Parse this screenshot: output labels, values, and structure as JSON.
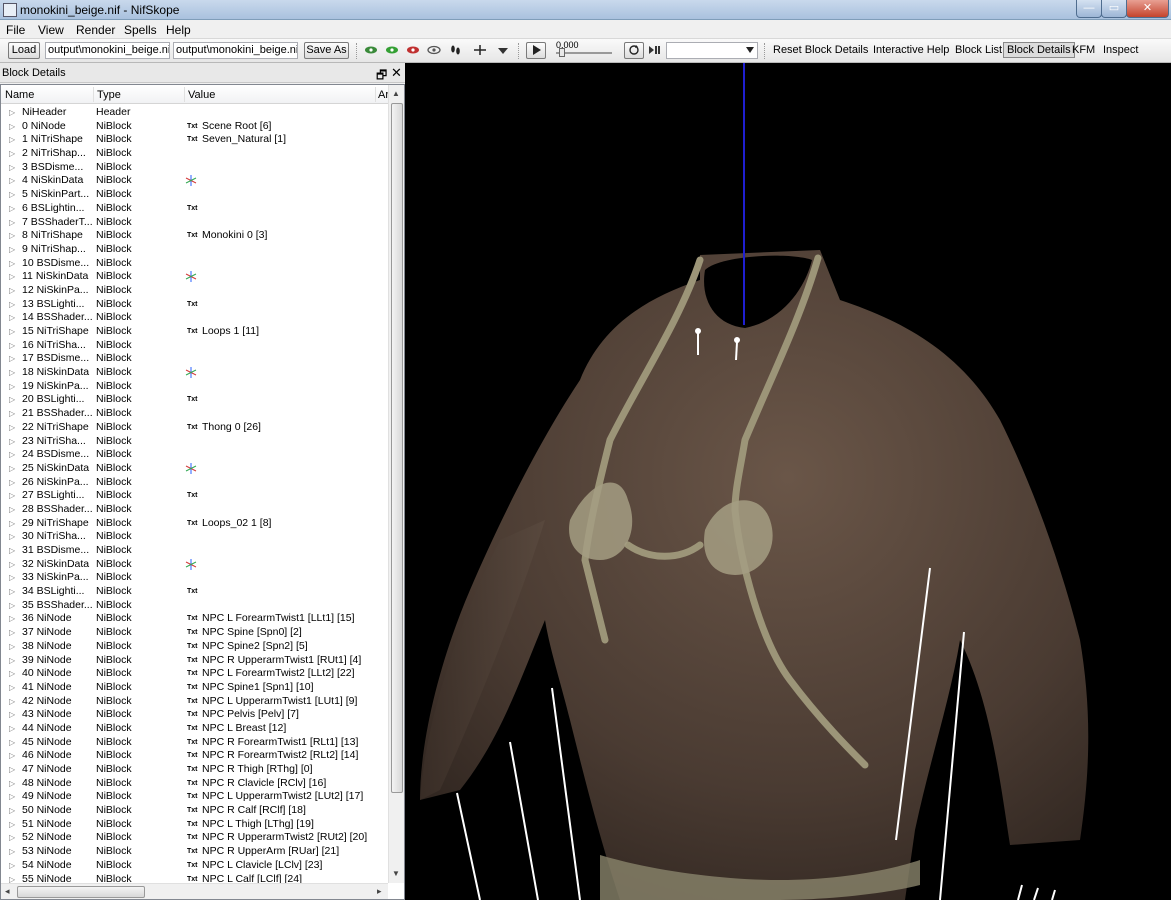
{
  "window": {
    "title": "monokini_beige.nif - NifSkope",
    "min_glyph": "—",
    "max_glyph": "▭",
    "close_glyph": "✕"
  },
  "menu": {
    "file": "File",
    "view": "View",
    "render": "Render",
    "spells": "Spells",
    "help": "Help"
  },
  "toolbar": {
    "load": "Load",
    "load_path": "output\\monokini_beige.nif",
    "save_path": "output\\monokini_beige.nif",
    "save_as": "Save As",
    "time_value": "0.000",
    "reset_block_details": "Reset Block Details",
    "interactive_help": "Interactive Help",
    "block_list": "Block List",
    "block_details": "Block Details",
    "kfm": "KFM",
    "inspect": "Inspect"
  },
  "dock": {
    "title": "Block Details",
    "float_glyph": "🗗",
    "close_glyph": "✕"
  },
  "columns": {
    "name": "Name",
    "type": "Type",
    "value": "Value",
    "arg": "Ar"
  },
  "value_tag": "Txt",
  "rows": [
    {
      "name": "NiHeader",
      "type": "Header",
      "kind": "",
      "value": ""
    },
    {
      "name": "0 NiNode",
      "type": "NiBlock",
      "kind": "txt",
      "value": "Scene Root [6]"
    },
    {
      "name": "1 NiTriShape",
      "type": "NiBlock",
      "kind": "txt",
      "value": "Seven_Natural [1]"
    },
    {
      "name": "2 NiTriShap...",
      "type": "NiBlock",
      "kind": "",
      "value": ""
    },
    {
      "name": "3 BSDisme...",
      "type": "NiBlock",
      "kind": "",
      "value": ""
    },
    {
      "name": "4 NiSkinData",
      "type": "NiBlock",
      "kind": "cross",
      "value": ""
    },
    {
      "name": "5 NiSkinPart...",
      "type": "NiBlock",
      "kind": "",
      "value": ""
    },
    {
      "name": "6 BSLightin...",
      "type": "NiBlock",
      "kind": "txt",
      "value": ""
    },
    {
      "name": "7 BSShaderT...",
      "type": "NiBlock",
      "kind": "",
      "value": ""
    },
    {
      "name": "8 NiTriShape",
      "type": "NiBlock",
      "kind": "txt",
      "value": "Monokini 0 [3]"
    },
    {
      "name": "9 NiTriShap...",
      "type": "NiBlock",
      "kind": "",
      "value": ""
    },
    {
      "name": "10 BSDisme...",
      "type": "NiBlock",
      "kind": "",
      "value": ""
    },
    {
      "name": "11 NiSkinData",
      "type": "NiBlock",
      "kind": "cross",
      "value": ""
    },
    {
      "name": "12 NiSkinPa...",
      "type": "NiBlock",
      "kind": "",
      "value": ""
    },
    {
      "name": "13 BSLighti...",
      "type": "NiBlock",
      "kind": "txt",
      "value": ""
    },
    {
      "name": "14 BSShader...",
      "type": "NiBlock",
      "kind": "",
      "value": ""
    },
    {
      "name": "15 NiTriShape",
      "type": "NiBlock",
      "kind": "txt",
      "value": "Loops 1 [11]"
    },
    {
      "name": "16 NiTriSha...",
      "type": "NiBlock",
      "kind": "",
      "value": ""
    },
    {
      "name": "17 BSDisme...",
      "type": "NiBlock",
      "kind": "",
      "value": ""
    },
    {
      "name": "18 NiSkinData",
      "type": "NiBlock",
      "kind": "cross",
      "value": ""
    },
    {
      "name": "19 NiSkinPa...",
      "type": "NiBlock",
      "kind": "",
      "value": ""
    },
    {
      "name": "20 BSLighti...",
      "type": "NiBlock",
      "kind": "txt",
      "value": ""
    },
    {
      "name": "21 BSShader...",
      "type": "NiBlock",
      "kind": "",
      "value": ""
    },
    {
      "name": "22 NiTriShape",
      "type": "NiBlock",
      "kind": "txt",
      "value": "Thong 0 [26]"
    },
    {
      "name": "23 NiTriSha...",
      "type": "NiBlock",
      "kind": "",
      "value": ""
    },
    {
      "name": "24 BSDisme...",
      "type": "NiBlock",
      "kind": "",
      "value": ""
    },
    {
      "name": "25 NiSkinData",
      "type": "NiBlock",
      "kind": "cross",
      "value": ""
    },
    {
      "name": "26 NiSkinPa...",
      "type": "NiBlock",
      "kind": "",
      "value": ""
    },
    {
      "name": "27 BSLighti...",
      "type": "NiBlock",
      "kind": "txt",
      "value": ""
    },
    {
      "name": "28 BSShader...",
      "type": "NiBlock",
      "kind": "",
      "value": ""
    },
    {
      "name": "29 NiTriShape",
      "type": "NiBlock",
      "kind": "txt",
      "value": "Loops_02 1 [8]"
    },
    {
      "name": "30 NiTriSha...",
      "type": "NiBlock",
      "kind": "",
      "value": ""
    },
    {
      "name": "31 BSDisme...",
      "type": "NiBlock",
      "kind": "",
      "value": ""
    },
    {
      "name": "32 NiSkinData",
      "type": "NiBlock",
      "kind": "cross",
      "value": ""
    },
    {
      "name": "33 NiSkinPa...",
      "type": "NiBlock",
      "kind": "",
      "value": ""
    },
    {
      "name": "34 BSLighti...",
      "type": "NiBlock",
      "kind": "txt",
      "value": ""
    },
    {
      "name": "35 BSShader...",
      "type": "NiBlock",
      "kind": "",
      "value": ""
    },
    {
      "name": "36 NiNode",
      "type": "NiBlock",
      "kind": "txt",
      "value": "NPC L ForearmTwist1 [LLt1] [15]"
    },
    {
      "name": "37 NiNode",
      "type": "NiBlock",
      "kind": "txt",
      "value": "NPC Spine [Spn0] [2]"
    },
    {
      "name": "38 NiNode",
      "type": "NiBlock",
      "kind": "txt",
      "value": "NPC Spine2 [Spn2] [5]"
    },
    {
      "name": "39 NiNode",
      "type": "NiBlock",
      "kind": "txt",
      "value": "NPC R UpperarmTwist1 [RUt1] [4]"
    },
    {
      "name": "40 NiNode",
      "type": "NiBlock",
      "kind": "txt",
      "value": "NPC L ForearmTwist2 [LLt2] [22]"
    },
    {
      "name": "41 NiNode",
      "type": "NiBlock",
      "kind": "txt",
      "value": "NPC Spine1 [Spn1] [10]"
    },
    {
      "name": "42 NiNode",
      "type": "NiBlock",
      "kind": "txt",
      "value": "NPC L UpperarmTwist1 [LUt1] [9]"
    },
    {
      "name": "43 NiNode",
      "type": "NiBlock",
      "kind": "txt",
      "value": "NPC Pelvis [Pelv] [7]"
    },
    {
      "name": "44 NiNode",
      "type": "NiBlock",
      "kind": "txt",
      "value": "NPC L Breast [12]"
    },
    {
      "name": "45 NiNode",
      "type": "NiBlock",
      "kind": "txt",
      "value": "NPC R ForearmTwist1 [RLt1] [13]"
    },
    {
      "name": "46 NiNode",
      "type": "NiBlock",
      "kind": "txt",
      "value": "NPC R ForearmTwist2 [RLt2] [14]"
    },
    {
      "name": "47 NiNode",
      "type": "NiBlock",
      "kind": "txt",
      "value": "NPC R Thigh [RThg] [0]"
    },
    {
      "name": "48 NiNode",
      "type": "NiBlock",
      "kind": "txt",
      "value": "NPC R Clavicle [RClv] [16]"
    },
    {
      "name": "49 NiNode",
      "type": "NiBlock",
      "kind": "txt",
      "value": "NPC L UpperarmTwist2 [LUt2] [17]"
    },
    {
      "name": "50 NiNode",
      "type": "NiBlock",
      "kind": "txt",
      "value": "NPC R Calf [RClf] [18]"
    },
    {
      "name": "51 NiNode",
      "type": "NiBlock",
      "kind": "txt",
      "value": "NPC L Thigh [LThg] [19]"
    },
    {
      "name": "52 NiNode",
      "type": "NiBlock",
      "kind": "txt",
      "value": "NPC R UpperarmTwist2 [RUt2] [20]"
    },
    {
      "name": "53 NiNode",
      "type": "NiBlock",
      "kind": "txt",
      "value": "NPC R UpperArm [RUar] [21]"
    },
    {
      "name": "54 NiNode",
      "type": "NiBlock",
      "kind": "txt",
      "value": "NPC L Clavicle [LClv] [23]"
    },
    {
      "name": "55 NiNode",
      "type": "NiBlock",
      "kind": "txt",
      "value": "NPC L Calf [LClf] [24]"
    }
  ],
  "colors": {
    "axis_line": "#1f1fd0",
    "background": "#000000",
    "skin": "#4a3b33",
    "garment": "#9c9578",
    "bone_lines": "#ffffff"
  }
}
